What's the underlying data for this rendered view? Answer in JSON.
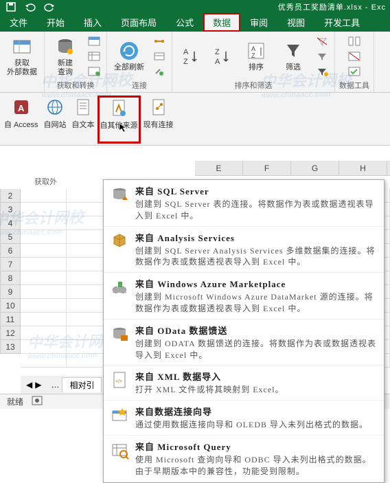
{
  "titlebar": {
    "title": "优秀员工奖励清单.xlsx - Exc"
  },
  "tabs": {
    "file": "文件",
    "home": "开始",
    "insert": "插入",
    "pagelayout": "页面布局",
    "formulas": "公式",
    "data": "数据",
    "review": "审阅",
    "view": "视图",
    "dev": "开发工具"
  },
  "ribbon": {
    "ext": {
      "label": "获取\n外部数据"
    },
    "get": {
      "newquery": "新建\n查询",
      "group": "获取和转换"
    },
    "refresh": {
      "label": "全部刷新",
      "group": "连接"
    },
    "sort": {
      "sort": "排序",
      "filter": "筛选",
      "group": "排序和筛选"
    },
    "tools": {
      "label": "数据工具"
    }
  },
  "subribbon": {
    "access": "自 Access",
    "web": "自网站",
    "text": "自文本",
    "other": "自其他来源",
    "existing": "现有连接",
    "group": "获取外"
  },
  "columns": [
    "E",
    "F",
    "G",
    "H"
  ],
  "rownums": [
    "2",
    "3",
    "4",
    "5",
    "6",
    "7",
    "8",
    "9",
    "10",
    "11",
    "12",
    "13"
  ],
  "menu": {
    "sql": {
      "title": "来自 SQL Server",
      "desc": "创建到 SQL Server 表的连接。将数据作为表或数据透视表导入到 Excel 中。"
    },
    "as": {
      "title": "来自 Analysis Services",
      "desc": "创建到 SQL Server Analysis Services 多维数据集的连接。将数据作为表或数据透视表导入到 Excel 中。"
    },
    "azure": {
      "title": "来自 Windows Azure Marketplace",
      "desc": "创建到 Microsoft Windows Azure DataMarket 源的连接。将数据作为表或数据透视表导入到 Excel 中。"
    },
    "odata": {
      "title": "来自 OData 数据馈送",
      "desc": "创建到 ODATA 数据馈送的连接。将数据作为表或数据透视表导入到 Excel 中。"
    },
    "xml": {
      "title": "来自 XML 数据导入",
      "desc": "打开 XML 文件或将其映射到 Excel。"
    },
    "wizard": {
      "title": "来自数据连接向导",
      "desc": "通过使用数据连接向导和 OLEDB 导入未列出格式的数据。"
    },
    "msquery": {
      "title": "来自 Microsoft Query",
      "desc": "使用 Microsoft 查询向导和 ODBC 导入未列出格式的数据。由于早期版本中的兼容性，功能受到限制。"
    }
  },
  "sheettab": {
    "name": "相对引"
  },
  "status": {
    "ready": "就绪"
  },
  "watermark": {
    "main": "中华会计网校",
    "sub": "www.chinaacc.com"
  }
}
